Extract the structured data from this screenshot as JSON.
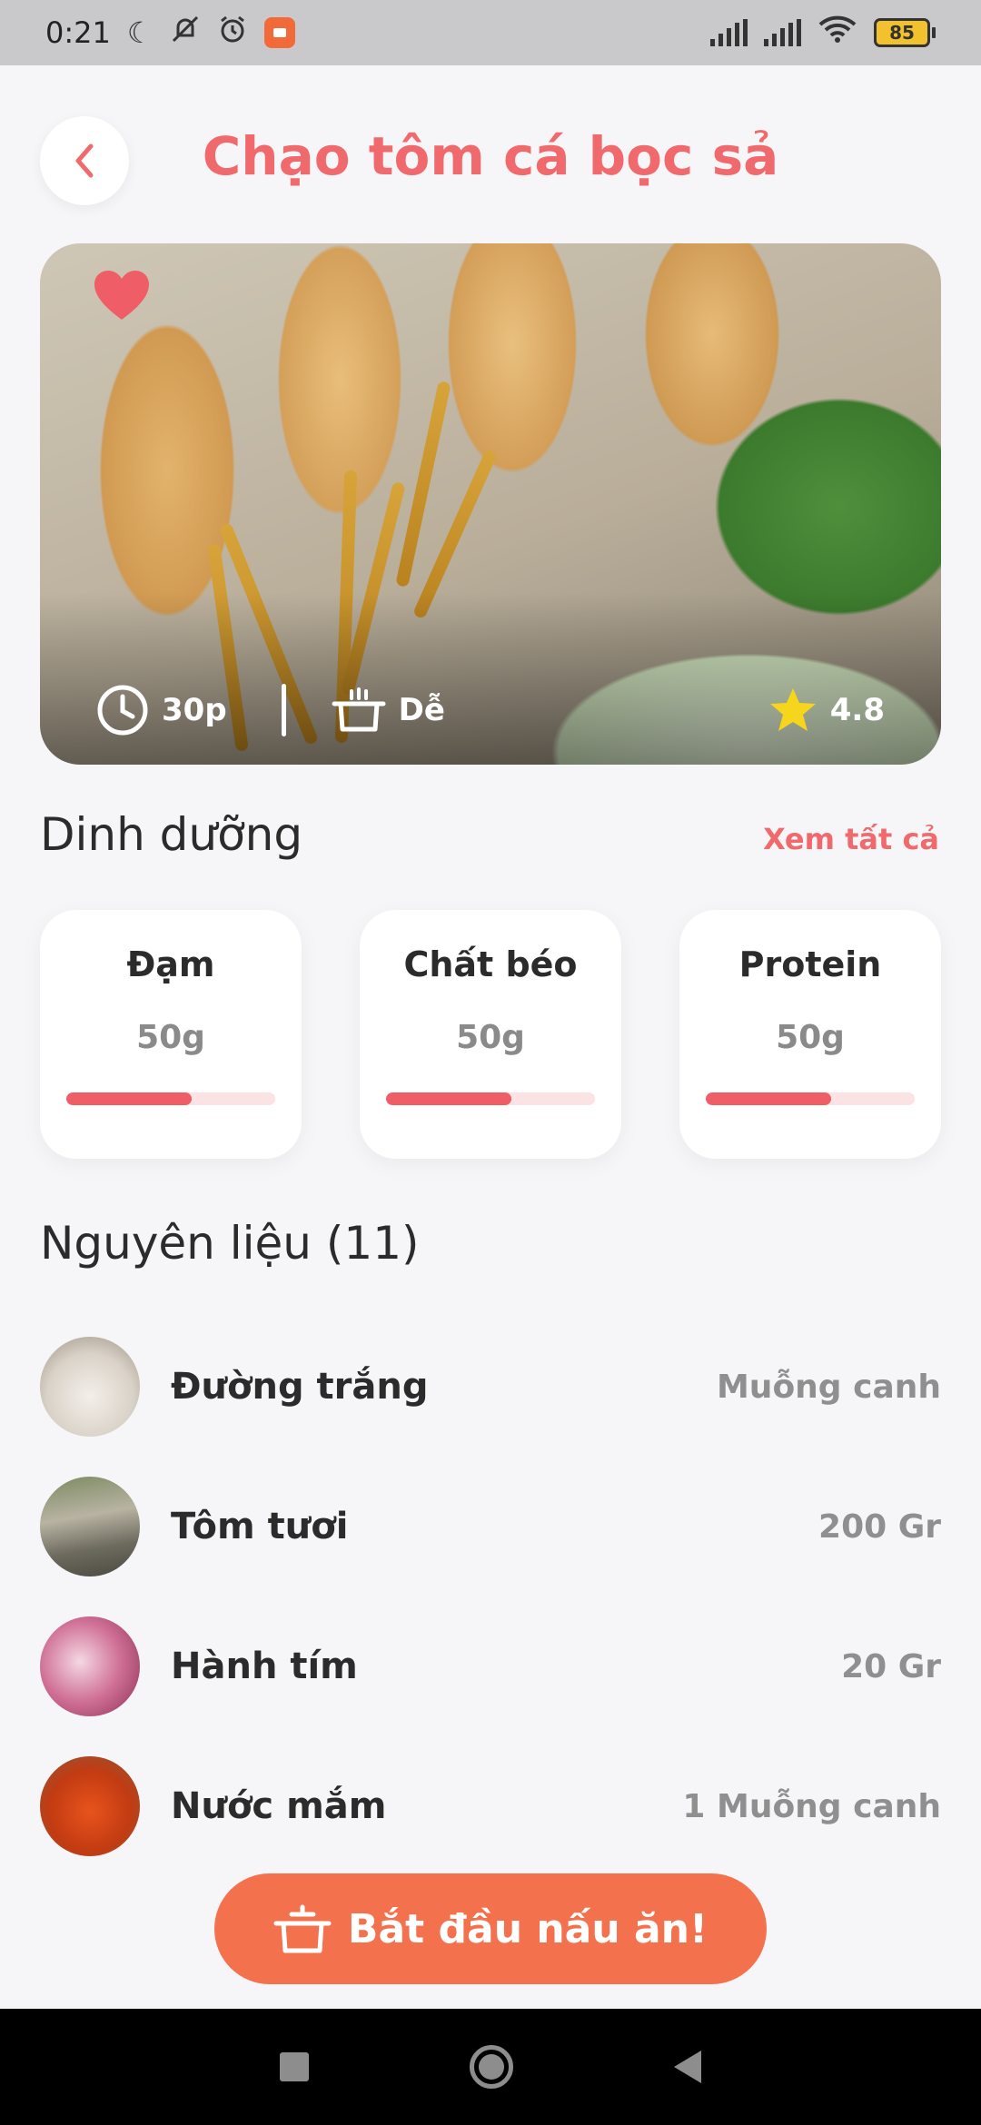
{
  "status_bar": {
    "time": "0:21",
    "battery": "85",
    "icons": [
      "moon-icon",
      "mute-icon",
      "alarm-icon",
      "screen-record-icon",
      "signal-icon",
      "signal-icon",
      "wifi-icon",
      "battery-icon"
    ]
  },
  "header": {
    "title": "Chạo tôm cá bọc sả",
    "back_icon": "chevron-left-icon"
  },
  "hero": {
    "favorite": true,
    "time": "30p",
    "difficulty": "Dễ",
    "rating": "4.8"
  },
  "nutrition": {
    "title": "Dinh dưỡng",
    "see_all": "Xem tất cả",
    "items": [
      {
        "name": "Đạm",
        "value": "50g",
        "progress": 0.6
      },
      {
        "name": "Chất béo",
        "value": "50g",
        "progress": 0.6
      },
      {
        "name": "Protein",
        "value": "50g",
        "progress": 0.6
      }
    ]
  },
  "ingredients": {
    "title": "Nguyên liệu (11)",
    "items": [
      {
        "name": "Đường trắng",
        "quantity": "Muỗng canh"
      },
      {
        "name": "Tôm tươi",
        "quantity": "200 Gr"
      },
      {
        "name": "Hành tím",
        "quantity": "20 Gr"
      },
      {
        "name": "Nước mắm",
        "quantity": "1 Muỗng canh"
      }
    ]
  },
  "cta": {
    "label": "Bắt đầu nấu ăn!"
  },
  "colors": {
    "accent": "#f06a6d",
    "cta": "#f4714e",
    "progress": "#ef5e66"
  }
}
